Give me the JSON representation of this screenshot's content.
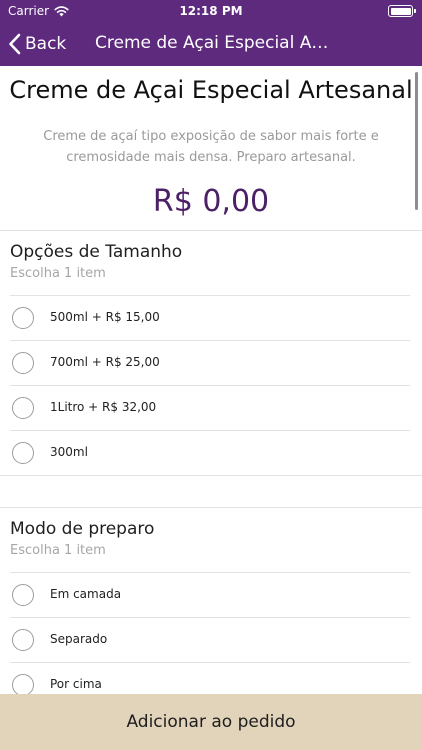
{
  "status_bar": {
    "carrier": "Carrier",
    "time": "12:18 PM"
  },
  "nav": {
    "back_label": "Back",
    "title": "Creme de Açai Especial Art..."
  },
  "product": {
    "title": "Creme de Açai Especial Artesanal",
    "description": "Creme de açaí tipo exposição de sabor mais forte e cremosidade mais densa. Preparo artesanal.",
    "price": "R$ 0,00"
  },
  "groups": [
    {
      "title": "Opções de Tamanho",
      "subtitle": "Escolha 1 item",
      "options": [
        "500ml + R$ 15,00",
        "700ml + R$ 25,00",
        "1Litro + R$ 32,00",
        "300ml"
      ]
    },
    {
      "title": "Modo de preparo",
      "subtitle": "Escolha 1 item",
      "options": [
        "Em camada",
        "Separado",
        "Por cima"
      ]
    }
  ],
  "add_button_label": "Adicionar ao pedido",
  "colors": {
    "header": "#5e2a7e",
    "price": "#4c1f66",
    "add_button": "#e1d4ba"
  }
}
